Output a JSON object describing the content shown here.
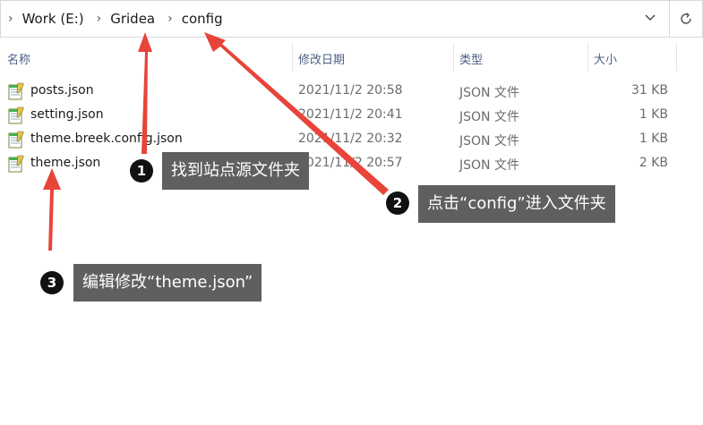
{
  "breadcrumb": [
    {
      "label": "Work (E:)"
    },
    {
      "label": "Gridea"
    },
    {
      "label": "config"
    }
  ],
  "columns": {
    "name": "名称",
    "date": "修改日期",
    "type": "类型",
    "size": "大小"
  },
  "files": [
    {
      "name": "posts.json",
      "date": "2021/11/2 20:58",
      "type": "JSON 文件",
      "size": "31 KB"
    },
    {
      "name": "setting.json",
      "date": "2021/11/2 20:41",
      "type": "JSON 文件",
      "size": "1 KB"
    },
    {
      "name": "theme.breek.config.json",
      "date": "2021/11/2 20:32",
      "type": "JSON 文件",
      "size": "1 KB"
    },
    {
      "name": "theme.json",
      "date": "2021/11/2 20:57",
      "type": "JSON 文件",
      "size": "2 KB"
    }
  ],
  "annotations": [
    {
      "number": "1",
      "text": "找到站点源文件夹"
    },
    {
      "number": "2",
      "text": "点击“config”进入文件夹"
    },
    {
      "number": "3",
      "text": "编辑修改“theme.json”"
    }
  ],
  "colors": {
    "arrow": "#e8443a",
    "callout_bg": "#5f5f5f",
    "header_text": "#4d6082"
  },
  "icons": {
    "address_dropdown": "chevron-down-icon",
    "refresh": "refresh-icon",
    "breadcrumb_separator": "chevron-right-icon",
    "file": "json-file-icon"
  }
}
